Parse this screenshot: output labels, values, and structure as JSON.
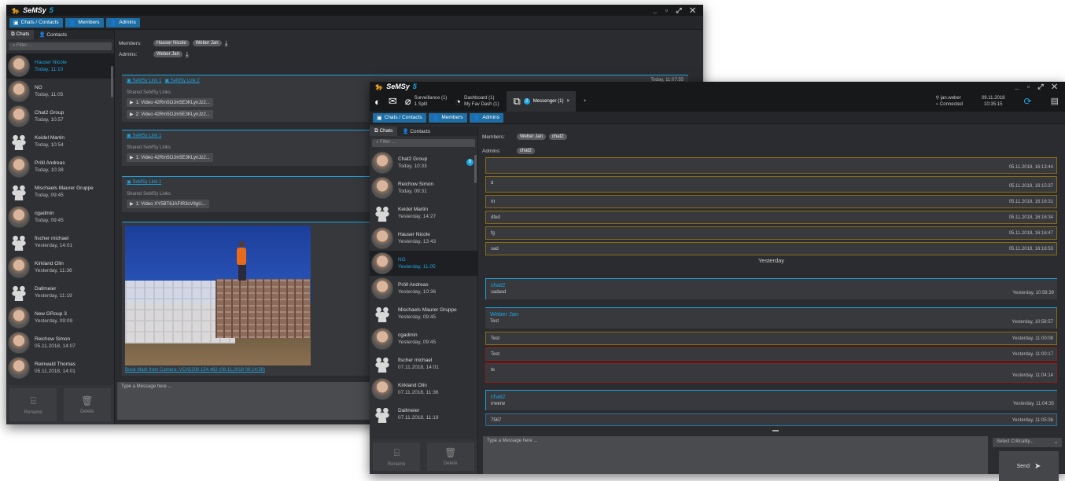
{
  "app": {
    "logo": "SeMSy",
    "logo_suffix": "5"
  },
  "win1": {
    "nav": {
      "chats": "Chats / Contacts",
      "members": "Members",
      "admins": "Admins"
    },
    "tabs": {
      "chats": "Chats",
      "contacts": "Contacts"
    },
    "filter_placeholder": "Filter ...",
    "chats": [
      {
        "name": "Hauser Nicole",
        "date": "Today, 11:10",
        "group": false,
        "selected": true
      },
      {
        "name": "NG",
        "date": "Today, 11:05",
        "group": false
      },
      {
        "name": "Chat2 Group",
        "date": "Today, 10:57",
        "group": false
      },
      {
        "name": "Keidel Martin",
        "date": "Today, 10:54",
        "group": true
      },
      {
        "name": "Pröll Andreas",
        "date": "Today, 10:38",
        "group": false
      },
      {
        "name": "Mischaels Maurer Gruppe",
        "date": "Today, 09:45",
        "group": true
      },
      {
        "name": "cgadmin",
        "date": "Today, 09:45",
        "group": false
      },
      {
        "name": "fischer michael",
        "date": "Yesterday, 14:01",
        "group": true
      },
      {
        "name": "Kirkland Olin",
        "date": "Yesterday, 11:36",
        "group": false
      },
      {
        "name": "Dallmeier",
        "date": "Yesterday, 11:19",
        "group": true
      },
      {
        "name": "New GRoup 3",
        "date": "Yesterday, 09:09",
        "group": false
      },
      {
        "name": "Reichow Simon",
        "date": "05.11.2018, 14:07",
        "group": false
      },
      {
        "name": "Reinwald Thomas",
        "date": "05.11.2018, 14:01",
        "group": false
      }
    ],
    "footer": {
      "rename": "Rename",
      "delete": "Delete"
    },
    "members_label": "Members:",
    "members": [
      "Hauser Nicole",
      "Weber Jan"
    ],
    "admins_label": "Admins:",
    "admins": [
      "Weber Jan"
    ],
    "card1": {
      "link1": "SeMSy Link 1",
      "link2": "SeMSy Link 2",
      "time": "Today, 11:07:55",
      "shared": "Shared SeMSy Links",
      "videos": [
        "1: Video 42Rm5OJm5E3KLynJz2...",
        "2: Video 42Rm5OJm5E3KLynJz2..."
      ]
    },
    "card2": {
      "link": "SeMSy Link 1",
      "shared": "Shared SeMSy Links",
      "videos": [
        "1: Video 42Rm5OJm5E3KLynJz2..."
      ]
    },
    "card3": {
      "link": "SeMSy Link 1",
      "shared": "Shared SeMSy Links",
      "videos": [
        "1: Video XY5BT6JAFIR3cVItgU..."
      ]
    },
    "bookmark": "Book Mark from Camera: VCA5200.154.462 (08.11.2018 09:14:58)",
    "input_placeholder": "Type a Message here ..."
  },
  "win2": {
    "top": {
      "surveillance": "Surveillance (1)",
      "surveillance_sub": "1 Split",
      "dashboard": "Dashboard (1)",
      "dashboard_sub": "My Fav Dash (1)",
      "messenger": "Messenger (1)",
      "msg_badge": "2",
      "user": "jan.weber",
      "status": "Connected",
      "date": "09.11.2018",
      "time": "10:35:15",
      "plus": "+",
      "close": "×"
    },
    "nav": {
      "chats": "Chats / Contacts",
      "members": "Members",
      "admins": "Admins"
    },
    "tabs": {
      "chats": "Chats",
      "contacts": "Contacts"
    },
    "filter_placeholder": "Filter ...",
    "chats": [
      {
        "name": "Chat2 Group",
        "date": "Today, 10:33",
        "group": false,
        "badge": "8"
      },
      {
        "name": "Reichow Simon",
        "date": "Today, 09:31",
        "group": false
      },
      {
        "name": "Keidel Martin",
        "date": "Yesterday, 14:27",
        "group": true
      },
      {
        "name": "Hauser Nicole",
        "date": "Yesterday, 13:43",
        "group": false
      },
      {
        "name": "NG",
        "date": "Yesterday, 11:05",
        "group": false,
        "selected": true
      },
      {
        "name": "Pröll Andreas",
        "date": "Yesterday, 10:36",
        "group": false
      },
      {
        "name": "Mischaels Maurer Gruppe",
        "date": "Yesterday, 09:45",
        "group": true
      },
      {
        "name": "cgadmin",
        "date": "Yesterday, 09:45",
        "group": false
      },
      {
        "name": "fischer michael",
        "date": "07.11.2018, 14:01",
        "group": true
      },
      {
        "name": "Kirkland Olin",
        "date": "07.11.2018, 11:36",
        "group": false
      },
      {
        "name": "Dallmeier",
        "date": "07.11.2018, 11:19",
        "group": true
      }
    ],
    "footer": {
      "rename": "Rename",
      "delete": "Delete"
    },
    "members_label": "Members:",
    "members": [
      "Weber Jan",
      "chat2"
    ],
    "admins_label": "Admins:",
    "admins": [
      "chat2"
    ],
    "messages": [
      {
        "text": "",
        "date": "05.11.2018, 16:13:44",
        "style": "gold",
        "h": 21
      },
      {
        "text": "d",
        "date": "05.11.2018, 16:15:37",
        "style": "gold",
        "h": 21
      },
      {
        "text": "rtr",
        "date": "05.11.2018, 16:16:31",
        "style": "gold",
        "h": 17
      },
      {
        "text": "dfed",
        "date": "05.11.2018, 16:16:34",
        "style": "gold",
        "h": 17
      },
      {
        "text": "fg",
        "date": "05.11.2018, 16:16:47",
        "style": "gold",
        "h": 17
      },
      {
        "text": "sad",
        "date": "05.11.2018, 16:16:53",
        "style": "gold",
        "h": 17
      }
    ],
    "day_separator": "Yesterday",
    "m_chat2a": {
      "sender": "chat2",
      "text": "sadasd",
      "date": "Yesterday, 10:58:39"
    },
    "m_weber": {
      "sender": "Weber Jan",
      "text": "Test",
      "date": "Yesterday, 10:58:57"
    },
    "m_test2": {
      "text": "Test",
      "date": "Yesterday, 11:00:08"
    },
    "m_test3": {
      "text": "Test",
      "date": "Yesterday, 11:00:17"
    },
    "m_te": {
      "text": "te",
      "date": "Yesterday, 11:04:14"
    },
    "m_chat2b": {
      "sender": "chat2",
      "text": "rrwerw",
      "date": "Yesterday, 11:04:35"
    },
    "m_7567": {
      "text": "7567",
      "date": "Yesterday, 11:05:36"
    },
    "input_placeholder": "Type a Message here ...",
    "criticality": "Select Criticality...",
    "send": "Send"
  }
}
